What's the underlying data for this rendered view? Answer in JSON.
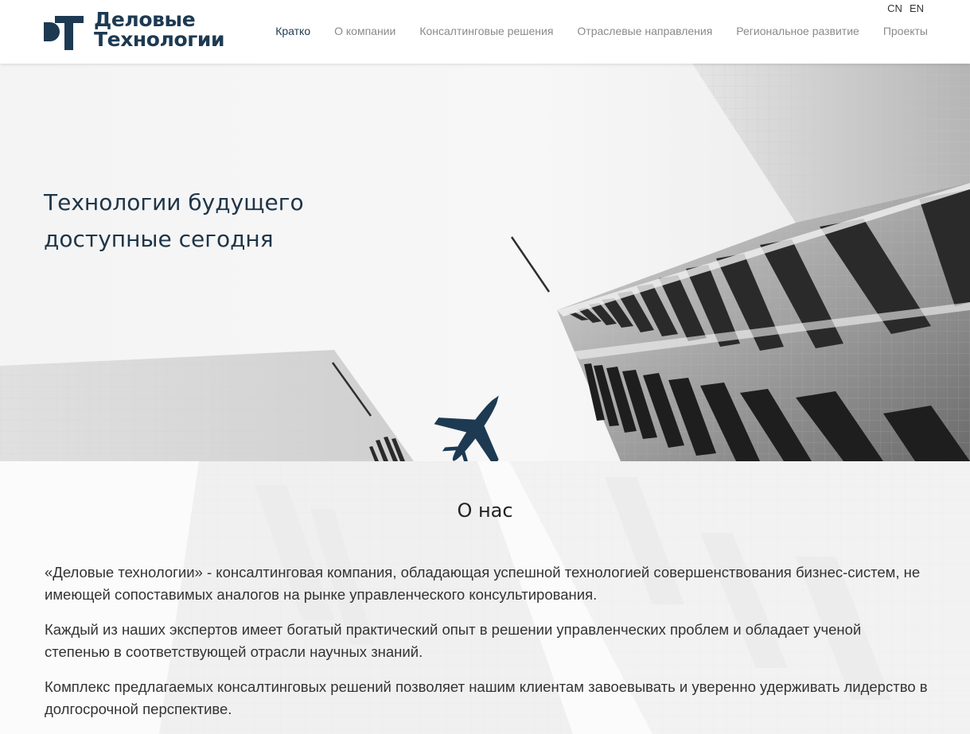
{
  "header": {
    "logo": {
      "line1": "Деловые",
      "line2": "Технологии",
      "mark_color": "#1d3a52"
    },
    "languages": [
      "CN",
      "EN"
    ],
    "nav": [
      {
        "label": "Кратко",
        "active": true
      },
      {
        "label": "О компании",
        "active": false
      },
      {
        "label": "Консалтинговые решения",
        "active": false
      },
      {
        "label": "Отраслевые направления",
        "active": false
      },
      {
        "label": "Региональное развитие",
        "active": false
      },
      {
        "label": "Проекты",
        "active": false
      }
    ]
  },
  "hero": {
    "title_line1": "Технологии будущего",
    "title_line2": "доступные сегодня",
    "image_icon": "airplane-between-skyscrapers"
  },
  "about": {
    "title": "О нас",
    "paragraphs": [
      "«Деловые технологии» - консалтинговая компания, обладающая успешной технологией совершенствования бизнес-систем, не имеющей сопоставимых аналогов на рынке управленческого консультирования.",
      "Каждый из наших экспертов имеет богатый практический опыт в решении управленческих проблем и обладает ученой степенью в соответствующей отрасли научных знаний.",
      "Комплекс предлагаемых консалтинговых решений позволяет нашим клиентам завоевывать и уверенно удерживать лидерство в долгосрочной перспективе."
    ]
  },
  "colors": {
    "brand": "#1d3a52",
    "nav_inactive": "#8a8a8a",
    "text": "#333333"
  }
}
